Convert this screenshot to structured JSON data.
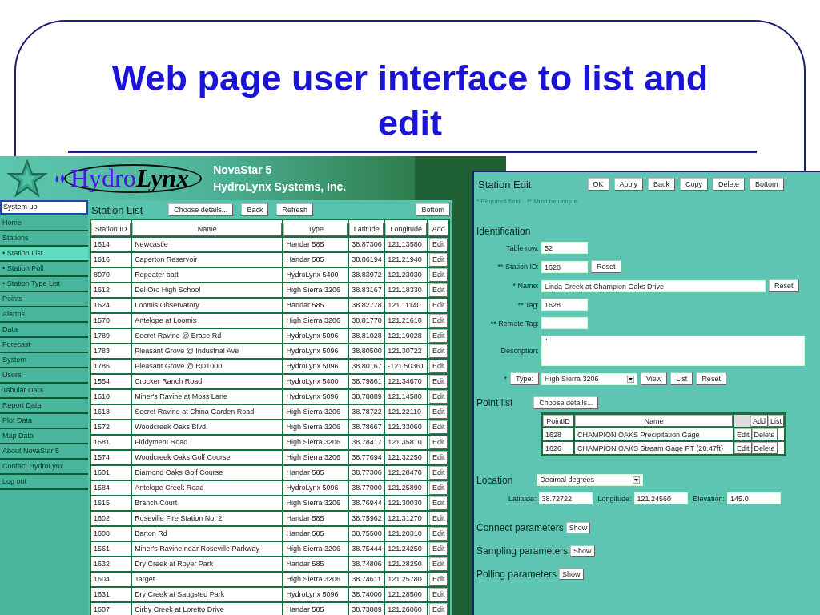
{
  "slide_title": "Web page user interface to list and edit",
  "list_screen": {
    "header": {
      "brand_first": "Hydro",
      "brand_second": "Lynx",
      "product": "NovaStar 5",
      "company": "HydroLynx Systems, Inc."
    },
    "status_field": {
      "value": "System up"
    },
    "sidebar": {
      "items": [
        {
          "label": "Home",
          "selected": false
        },
        {
          "label": "Stations",
          "selected": false
        },
        {
          "label": "• Station List",
          "selected": true
        },
        {
          "label": "• Station Poll",
          "selected": false
        },
        {
          "label": "• Station Type List",
          "selected": false
        },
        {
          "label": "Points",
          "selected": false
        },
        {
          "label": "Alarms",
          "selected": false
        },
        {
          "label": "Data",
          "selected": false
        },
        {
          "label": "Forecast",
          "selected": false
        },
        {
          "label": "System",
          "selected": false
        },
        {
          "label": "Users",
          "selected": false
        },
        {
          "label": "Tabular Data",
          "selected": false
        },
        {
          "label": "Report Data",
          "selected": false
        },
        {
          "label": "Plot Data",
          "selected": false
        },
        {
          "label": "Map Data",
          "selected": false
        },
        {
          "label": "About NovaStar 5",
          "selected": false
        },
        {
          "label": "Contact HydroLynx",
          "selected": false
        },
        {
          "label": "Log out",
          "selected": false
        }
      ]
    },
    "station_list": {
      "title": "Station List",
      "buttons": [
        "Choose details...",
        "Back",
        "Refresh"
      ],
      "bottom_button": "Bottom",
      "columns": [
        "Station ID",
        "Name",
        "Type",
        "Latitude",
        "Longitude",
        "Add"
      ],
      "rows": [
        {
          "station_id": "1614",
          "name": "Newcastle",
          "type": "Handar 585",
          "latitude": "38.87306",
          "longitude": "121.13580",
          "action": "Edit"
        },
        {
          "station_id": "1616",
          "name": "Caperton Reservoir",
          "type": "Handar 585",
          "latitude": "38.86194",
          "longitude": "121.21940",
          "action": "Edit"
        },
        {
          "station_id": "8070",
          "name": "Repeater batt",
          "type": "HydroLynx 5400",
          "latitude": "38.83972",
          "longitude": "121.23030",
          "action": "Edit"
        },
        {
          "station_id": "1612",
          "name": "Del Oro High School",
          "type": "High Sierra 3206",
          "latitude": "38.83167",
          "longitude": "121.18330",
          "action": "Edit"
        },
        {
          "station_id": "1624",
          "name": "Loomis Observatory",
          "type": "Handar 585",
          "latitude": "38.82778",
          "longitude": "121.11140",
          "action": "Edit"
        },
        {
          "station_id": "1570",
          "name": "Antelope at Loomis",
          "type": "High Sierra 3206",
          "latitude": "38.81778",
          "longitude": "121.21610",
          "action": "Edit"
        },
        {
          "station_id": "1789",
          "name": "Secret Ravine @ Brace Rd",
          "type": "HydroLynx 5096",
          "latitude": "38.81028",
          "longitude": "121.19028",
          "action": "Edit"
        },
        {
          "station_id": "1783",
          "name": "Pleasant Grove @ Industrial Ave",
          "type": "HydroLynx 5096",
          "latitude": "38.80500",
          "longitude": "121.30722",
          "action": "Edit"
        },
        {
          "station_id": "1786",
          "name": "Pleasant Grove @ RD1000",
          "type": "HydroLynx 5096",
          "latitude": "38.80167",
          "longitude": "-121.50361",
          "action": "Edit"
        },
        {
          "station_id": "1554",
          "name": "Crocker Ranch Road",
          "type": "HydroLynx 5400",
          "latitude": "38.79861",
          "longitude": "121.34670",
          "action": "Edit"
        },
        {
          "station_id": "1610",
          "name": "Miner's Ravine at Moss Lane",
          "type": "HydroLynx 5096",
          "latitude": "38.78889",
          "longitude": "121.14580",
          "action": "Edit"
        },
        {
          "station_id": "1618",
          "name": "Secret Ravine at China Garden Road",
          "type": "High Sierra 3206",
          "latitude": "38.78722",
          "longitude": "121.22110",
          "action": "Edit"
        },
        {
          "station_id": "1572",
          "name": "Woodcreek Oaks Blvd.",
          "type": "High Sierra 3206",
          "latitude": "38.78667",
          "longitude": "121.33060",
          "action": "Edit"
        },
        {
          "station_id": "1581",
          "name": "Fiddyment Road",
          "type": "High Sierra 3206",
          "latitude": "38.78417",
          "longitude": "121.35810",
          "action": "Edit"
        },
        {
          "station_id": "1574",
          "name": "Woodcreek Oaks Golf Course",
          "type": "High Sierra 3206",
          "latitude": "38.77694",
          "longitude": "121.32250",
          "action": "Edit"
        },
        {
          "station_id": "1601",
          "name": "Diamond Oaks Golf Course",
          "type": "Handar 585",
          "latitude": "38.77306",
          "longitude": "121.28470",
          "action": "Edit"
        },
        {
          "station_id": "1584",
          "name": "Antelope Creek Road",
          "type": "HydroLynx 5096",
          "latitude": "38.77000",
          "longitude": "121.25890",
          "action": "Edit"
        },
        {
          "station_id": "1615",
          "name": "Branch Court",
          "type": "High Sierra 3206",
          "latitude": "38.76944",
          "longitude": "121.30030",
          "action": "Edit"
        },
        {
          "station_id": "1602",
          "name": "Roseville Fire Station No. 2",
          "type": "Handar 585",
          "latitude": "38.75962",
          "longitude": "121.31270",
          "action": "Edit"
        },
        {
          "station_id": "1608",
          "name": "Barton Rd",
          "type": "Handar 585",
          "latitude": "38.75500",
          "longitude": "121.20310",
          "action": "Edit"
        },
        {
          "station_id": "1561",
          "name": "Miner's Ravine near Roseville Parkway",
          "type": "High Sierra 3206",
          "latitude": "38.75444",
          "longitude": "121.24250",
          "action": "Edit"
        },
        {
          "station_id": "1632",
          "name": "Dry Creek at Royer Park",
          "type": "Handar 585",
          "latitude": "38.74806",
          "longitude": "121.28250",
          "action": "Edit"
        },
        {
          "station_id": "1604",
          "name": "Target",
          "type": "High Sierra 3206",
          "latitude": "38.74611",
          "longitude": "121.25780",
          "action": "Edit"
        },
        {
          "station_id": "1631",
          "name": "Dry Creek at Saugsted Park",
          "type": "HydroLynx 5096",
          "latitude": "38.74000",
          "longitude": "121.28500",
          "action": "Edit"
        },
        {
          "station_id": "1607",
          "name": "Cirby Creek at Loretto Drive",
          "type": "Handar 585",
          "latitude": "38.73889",
          "longitude": "121.26060",
          "action": "Edit"
        }
      ]
    }
  },
  "edit_screen": {
    "title": "Station Edit",
    "buttons": [
      "OK",
      "Apply",
      "Back",
      "Copy",
      "Delete",
      "Bottom"
    ],
    "legend": [
      "* Required field",
      "** Must be unique"
    ],
    "identification": {
      "heading": "Identification",
      "fields": [
        {
          "label": "Table row:",
          "value": "52",
          "kind": "short"
        },
        {
          "label": "** Station ID:",
          "value": "1628",
          "kind": "short",
          "button": "Reset"
        },
        {
          "label": "* Name:",
          "value": "Linda Creek at Champion Oaks Drive",
          "kind": "long",
          "button": "Reset"
        },
        {
          "label": "** Tag:",
          "value": "1628",
          "kind": "short"
        },
        {
          "label": "** Remote Tag:",
          "kind": "short"
        },
        {
          "label": "Description:",
          "value": "\"",
          "kind": "area"
        }
      ],
      "type_row": {
        "mark": "*",
        "label": "Type:",
        "value": "High Sierra 3206",
        "buttons": [
          "View",
          "List",
          "Reset"
        ]
      }
    },
    "point_list": {
      "heading": "Point list",
      "button": "Choose details...",
      "columns": [
        "PointID",
        "Name"
      ],
      "header_buttons": [
        "Add",
        "List"
      ],
      "rows": [
        {
          "point_id": "1628",
          "name": "CHAMPION OAKS Precipitation Gage",
          "actions": [
            "Edit",
            "Delete"
          ]
        },
        {
          "point_id": "1626",
          "name": "CHAMPION OAKS Stream Gage PT (20.47ft)",
          "actions": [
            "Edit",
            "Delete"
          ]
        }
      ]
    },
    "location": {
      "heading": "Location",
      "format": "Decimal degrees",
      "fields": [
        {
          "label": "Latitude:",
          "value": "38.72722"
        },
        {
          "label": "Longitude:",
          "value": "121.24560"
        },
        {
          "label": "Elevation:",
          "value": "145.0"
        }
      ]
    },
    "parameter_sections": [
      {
        "heading": "Connect parameters",
        "button": "Show"
      },
      {
        "heading": "Sampling parameters",
        "button": "Show"
      },
      {
        "heading": "Polling parameters",
        "button": "Show"
      }
    ]
  }
}
